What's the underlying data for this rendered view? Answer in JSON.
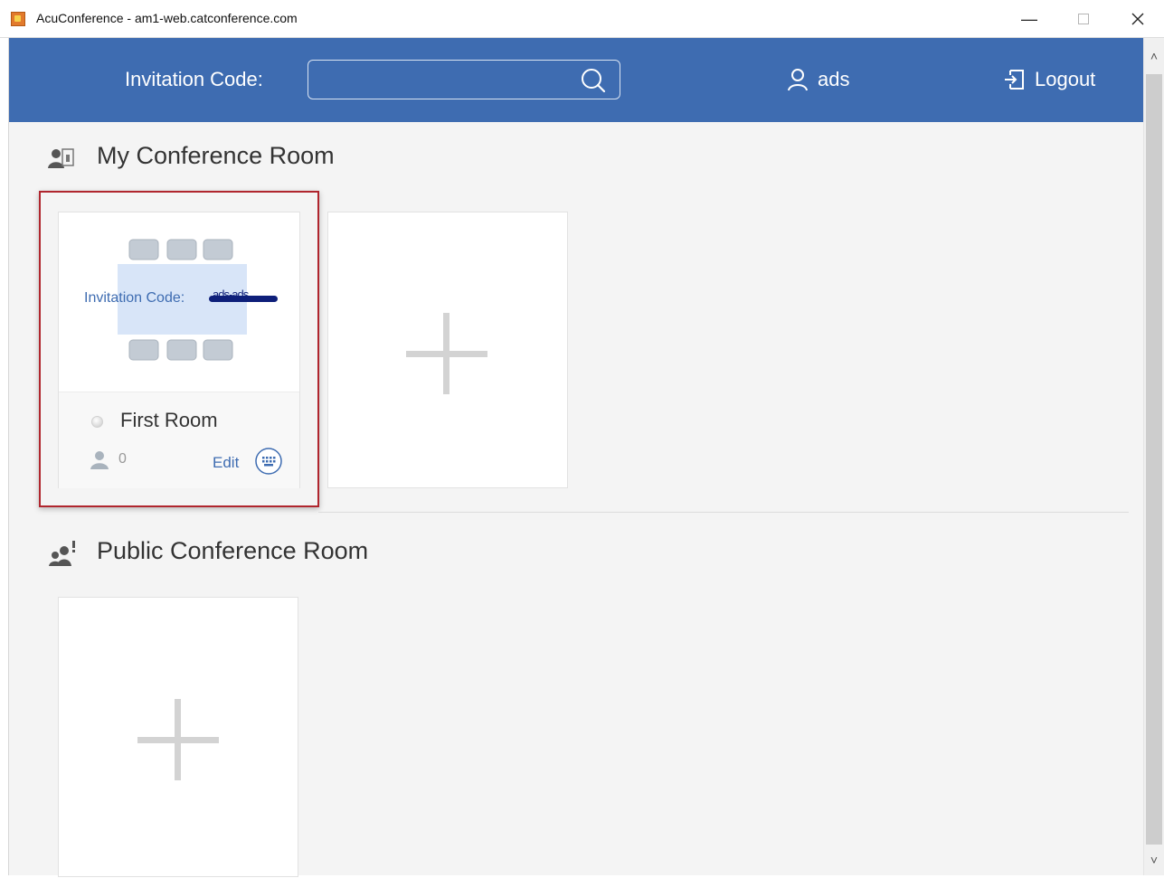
{
  "window": {
    "title": "AcuConference - am1-web.catconference.com",
    "minimize": "—",
    "maximize": "☐",
    "close": "✕"
  },
  "header": {
    "invitation_label": "Invitation Code:",
    "invitation_input_value": "",
    "username": "ads",
    "logout_label": "Logout"
  },
  "my_rooms": {
    "title": "My Conference Room",
    "rooms": [
      {
        "name": "First Room",
        "invitation_label": "Invitation Code:",
        "invitation_code_redacted": "ads-ads",
        "member_count": "0",
        "edit_label": "Edit"
      }
    ]
  },
  "public_rooms": {
    "title": "Public Conference Room"
  },
  "scrollbar": {
    "up": "˄",
    "down": "˅"
  },
  "colors": {
    "header_blue": "#3e6cb1",
    "highlight_red": "#b0262e",
    "content_bg": "#f4f4f4"
  }
}
